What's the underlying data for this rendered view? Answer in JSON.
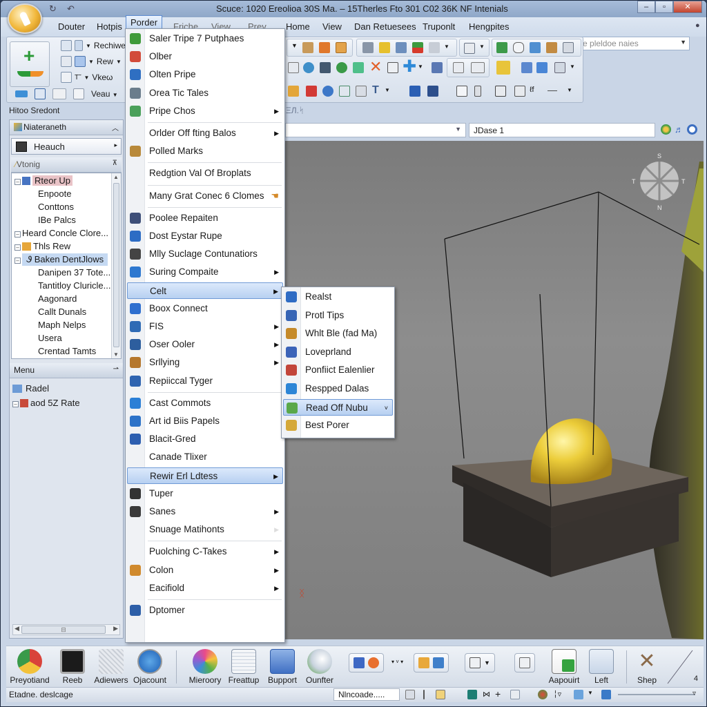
{
  "window": {
    "title": "Scuce: 1020 Ereolioa 30S Ma. – 15Therles Fto 301 C02 36K NF Intenials",
    "controls": [
      "minimize",
      "maximize",
      "close"
    ]
  },
  "menubar": {
    "tabs": [
      {
        "label": "Douter"
      },
      {
        "label": "Hotpis"
      },
      {
        "label": "Porder",
        "active": true
      },
      {
        "label": "Friche"
      },
      {
        "label": "View"
      },
      {
        "label": "Prev"
      },
      {
        "label": "Home"
      },
      {
        "label": "View"
      },
      {
        "label": "Dan Retuesees"
      },
      {
        "label": "Truponlt"
      },
      {
        "label": "Hengpites"
      }
    ],
    "search_placeholder": "Sehlce pleldoe naies"
  },
  "ribbon": {
    "left_group": {
      "items": [
        {
          "label": "Rechiwe",
          "icon": "layout-icon"
        },
        {
          "label": "Rew",
          "icon": "table-icon"
        },
        {
          "label": "Vkeω",
          "icon": "text-icon"
        },
        {
          "label": "Veau",
          "icon": "view-icon"
        }
      ],
      "big_button_icon": "add-icon"
    }
  },
  "section_label": "Hitoo Sredont",
  "section_label2": "ΞЛ.ᛋ",
  "sidebar": {
    "header": "Niateraneth",
    "dropdown": "Heauch",
    "tree_header": "Vtonig",
    "tree": [
      {
        "label": "Rteor Up",
        "level": 0,
        "expander": true,
        "state": "selected-red"
      },
      {
        "label": "Enpoote",
        "level": 1
      },
      {
        "label": "Conttons",
        "level": 1
      },
      {
        "label": "IBe Palcs",
        "level": 1
      },
      {
        "label": "Heard Concle Clore...",
        "level": 0,
        "expander": true
      },
      {
        "label": "Thls Rew",
        "level": 0,
        "expander": true
      },
      {
        "label": "Baken DentJlows",
        "level": 0,
        "expander": true,
        "state": "selected-blue"
      },
      {
        "label": "Danipen 37 Tote...",
        "level": 1
      },
      {
        "label": "Tantitloy Cluricle...",
        "level": 1
      },
      {
        "label": "Aagonard",
        "level": 1
      },
      {
        "label": "Callt Dunals",
        "level": 1
      },
      {
        "label": "Maph Nelps",
        "level": 1
      },
      {
        "label": "Usera",
        "level": 1
      },
      {
        "label": "Crentad Tamts",
        "level": 1
      }
    ],
    "menu_header": "Menu",
    "menu_items": [
      {
        "label": "Radel"
      },
      {
        "label": "aod 5Z Rate"
      }
    ]
  },
  "viewport_bar": {
    "combo1_value": "",
    "combo2_value": "JDase 1"
  },
  "viewport": {
    "compass": {
      "n": "S",
      "s": "N",
      "e": "T",
      "w": "T"
    }
  },
  "dropdown_menu": {
    "items": [
      {
        "label": "Saler Tripe 7 Putphaes",
        "icon": "brush-icon",
        "color": "#3f9a3a"
      },
      {
        "label": "Olber",
        "icon": "people-icon",
        "color": "#d24b3a"
      },
      {
        "label": "Olten Pripe",
        "icon": "font-icon",
        "color": "#2f6fc2"
      },
      {
        "label": "Orea Tic Tales",
        "icon": "database-icon",
        "color": "#6b7d8c"
      },
      {
        "label": "Pripe Chos",
        "icon": "chart-icon",
        "color": "#4aa05a",
        "submenu": true,
        "sep_after": true
      },
      {
        "label": "Orlder Off fting Balos",
        "submenu": true
      },
      {
        "label": "Polled Marks",
        "icon": "basket-icon",
        "color": "#b8893a",
        "sep_after": true
      },
      {
        "label": "Redgtion Val Of Broplats",
        "sep_after": true
      },
      {
        "label": "Many Grat Conec 6 Clomes",
        "trailing_icon": "hand-icon",
        "sep_after": true
      },
      {
        "label": "Poolee Repaiten",
        "icon": "package-icon",
        "color": "#3e4f78"
      },
      {
        "label": "Dost Eystar Rupe",
        "icon": "save-icon",
        "color": "#2c6cc4"
      },
      {
        "label": "Mlly Suclage Contunatiors",
        "icon": "gear-icon",
        "color": "#444"
      },
      {
        "label": "Suring Compaite",
        "icon": "user-icon",
        "color": "#2e78d0",
        "submenu": true
      },
      {
        "label": "Celt",
        "submenu": true,
        "highlighted": true
      },
      {
        "label": "Boox Connect",
        "icon": "connect-icon",
        "color": "#2e6fcf"
      },
      {
        "label": "FIS",
        "icon": "grid-icon",
        "color": "#2f6bb5",
        "submenu": true
      },
      {
        "label": "Oser Ooler",
        "icon": "image-icon",
        "color": "#2d5e9e",
        "submenu": true
      },
      {
        "label": "Srllying",
        "icon": "tools-icon",
        "color": "#b5772d",
        "submenu": true
      },
      {
        "label": "Repiiccal Tyger",
        "icon": "type-icon",
        "color": "#2f64b0",
        "sep_after": true
      },
      {
        "label": "Cast Commots",
        "icon": "comment-icon",
        "color": "#2b7fd6"
      },
      {
        "label": "Art id Biis Papels",
        "icon": "document-icon",
        "color": "#2c72c8"
      },
      {
        "label": "Blacit-Gred",
        "icon": "pin-icon",
        "color": "#2d5fb0"
      },
      {
        "label": "Canade Tlixer"
      },
      {
        "label": "Rewir Erl Ldtess",
        "submenu": true,
        "highlighted": true
      },
      {
        "label": "Tuper",
        "icon": "plugin-icon",
        "color": "#333"
      },
      {
        "label": "Sanes",
        "icon": "photo-icon",
        "color": "#3a3a3a",
        "submenu": true
      },
      {
        "label": "Snuage Matihonts",
        "submenu_disabled": true,
        "sep_after": true
      },
      {
        "label": "Puolching C-Takes",
        "submenu": true
      },
      {
        "label": "Colon",
        "icon": "folder-icon",
        "color": "#d08a2d",
        "submenu": true
      },
      {
        "label": "Eacifiold",
        "submenu": true,
        "sep_after": true
      },
      {
        "label": "Dptomer",
        "icon": "file-icon",
        "color": "#2d5fa8"
      }
    ]
  },
  "submenu": {
    "items": [
      {
        "label": "Realst",
        "icon": "cloud-icon",
        "color": "#2f6cc4"
      },
      {
        "label": "Protl Tips",
        "icon": "arrow-icon",
        "color": "#3765b5"
      },
      {
        "label": "Whlt Ble (fad Ma)",
        "icon": "lock-icon",
        "color": "#c58a2a"
      },
      {
        "label": "Loveprland",
        "icon": "pen-icon",
        "color": "#3b63b8"
      },
      {
        "label": "Ponfiict Ealenlier",
        "icon": "funnel-icon",
        "color": "#c2453a"
      },
      {
        "label": "Respped Dalas",
        "icon": "bird-icon",
        "color": "#2e86d6"
      },
      {
        "label": "Read Off Nubu",
        "icon": "folder-green-icon",
        "color": "#5aa84a",
        "highlighted": true
      },
      {
        "label": "Best Porer",
        "icon": "clipboard-icon",
        "color": "#d5a93a"
      }
    ]
  },
  "taskbar": {
    "apps": [
      {
        "label": "Preyotiand",
        "icon": "chrome-icon"
      },
      {
        "label": "Reeb",
        "icon": "chip-icon"
      },
      {
        "label": "Adiewers",
        "icon": "pattern-icon"
      },
      {
        "label": "Ojacount",
        "icon": "safari-icon"
      },
      {
        "label": "Mieroory",
        "icon": "flower-icon"
      },
      {
        "label": "Freattup",
        "icon": "list-icon"
      },
      {
        "label": "Bupport",
        "icon": "support-icon"
      },
      {
        "label": "Ounfter",
        "icon": "satellite-icon"
      }
    ],
    "right": [
      {
        "label": "Aapouirt",
        "icon": "export-icon"
      },
      {
        "label": "Left",
        "icon": "window-icon"
      },
      {
        "label": "Shep",
        "icon": "tools-cross-icon"
      }
    ],
    "corner_label": "4"
  },
  "statusbar": {
    "left": "Etadne. deslcage",
    "field": "Nlncoade....."
  }
}
